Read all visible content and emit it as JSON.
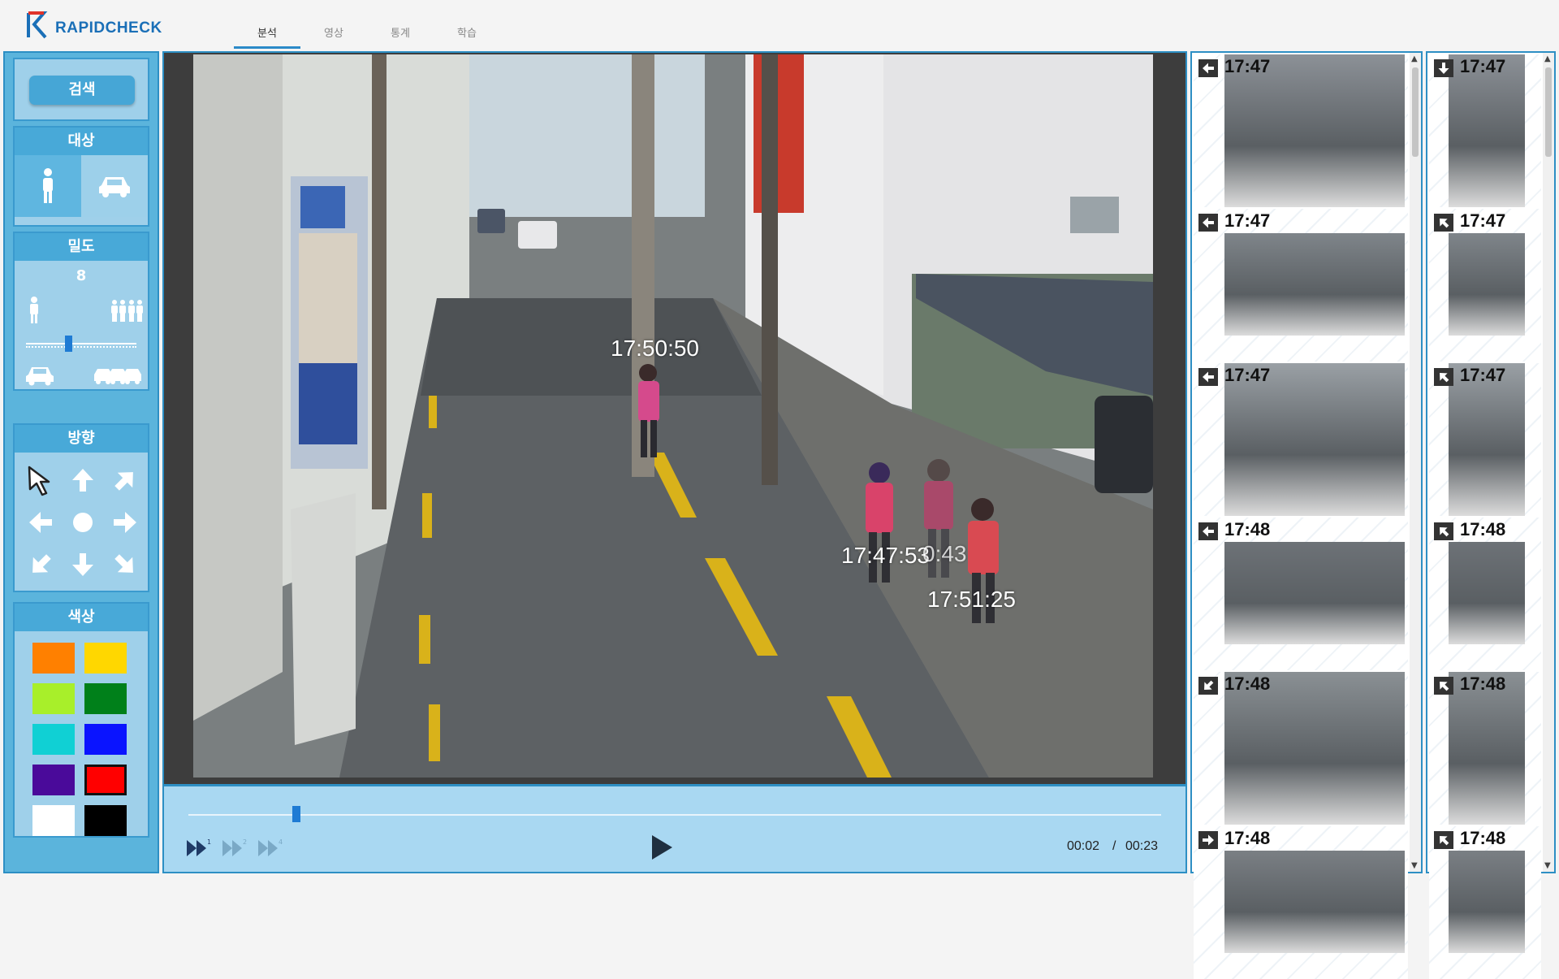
{
  "app": {
    "logo_text": "RAPIDCHECK"
  },
  "nav": {
    "tabs": [
      "분석",
      "영상",
      "통계",
      "학습"
    ],
    "active": 0
  },
  "sidebar": {
    "search_label": "검색",
    "target": {
      "title": "대상",
      "options": [
        "person-icon",
        "car-icon"
      ],
      "selected": 0
    },
    "density": {
      "title": "밀도",
      "value": "8"
    },
    "direction": {
      "title": "방향",
      "selected": "up-left"
    },
    "color": {
      "title": "색상",
      "swatches": [
        "#ff8000",
        "#ffd700",
        "#a8ef2a",
        "#00801a",
        "#10d0d4",
        "#0a14ff",
        "#4a0a9a",
        "#ff0000",
        "#ffffff",
        "#000000"
      ],
      "selected": 7
    }
  },
  "video": {
    "timestamps": [
      "17:50:50",
      "17:47:53",
      "0:43",
      "17:51:25"
    ],
    "current_time": "00:02",
    "time_separator": "/",
    "total_time": "00:23"
  },
  "thumbs_a": [
    {
      "time": "17:47",
      "icon": "arrow-left-icon"
    },
    {
      "time": "17:47",
      "icon": "arrow-left-icon"
    },
    {
      "time": "17:47",
      "icon": "arrow-left-icon"
    },
    {
      "time": "17:48",
      "icon": "arrow-left-icon"
    },
    {
      "time": "17:48",
      "icon": "arrow-down-left-icon"
    },
    {
      "time": "17:48",
      "icon": "arrow-right-icon"
    }
  ],
  "thumbs_b": [
    {
      "time": "17:47",
      "icon": "arrow-down-icon"
    },
    {
      "time": "17:47",
      "icon": "arrow-up-left-icon"
    },
    {
      "time": "17:47",
      "icon": "arrow-up-left-icon"
    },
    {
      "time": "17:48",
      "icon": "arrow-up-left-icon"
    },
    {
      "time": "17:48",
      "icon": "arrow-up-left-icon"
    },
    {
      "time": "17:48",
      "icon": "arrow-up-left-icon"
    }
  ]
}
